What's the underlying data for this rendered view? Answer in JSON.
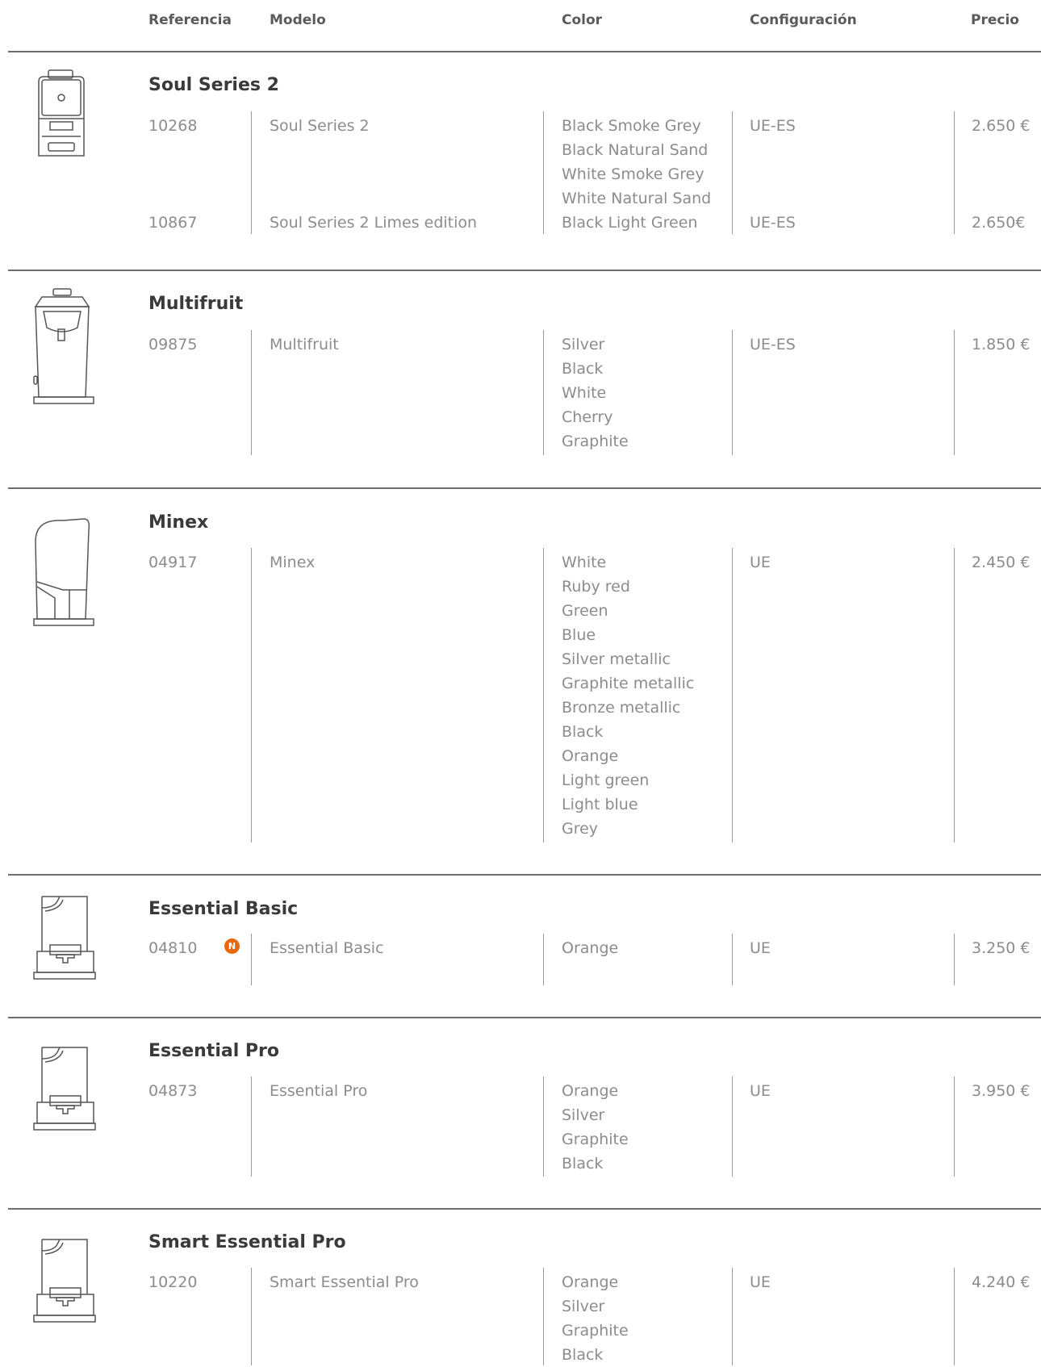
{
  "headers": {
    "referencia": "Referencia",
    "modelo": "Modelo",
    "color": "Color",
    "configuracion": "Configuración",
    "precio": "Precio"
  },
  "products": [
    {
      "name": "Soul Series 2",
      "icon": "soul-series-2-juicer-icon",
      "rows": [
        {
          "ref": "10268",
          "model": "Soul Series 2",
          "colors": [
            "Black Smoke Grey",
            "Black Natural Sand",
            "White Smoke Grey",
            "White Natural Sand"
          ],
          "config": "UE-ES",
          "price": "2.650 €"
        },
        {
          "ref": "10867",
          "model": "Soul Series 2 Limes edition",
          "colors": [
            "Black Light Green"
          ],
          "config": "UE-ES",
          "price": "2.650€"
        }
      ]
    },
    {
      "name": "Multifruit",
      "icon": "multifruit-juicer-icon",
      "rows": [
        {
          "ref": "09875",
          "model": "Multifruit",
          "colors": [
            "Silver",
            "Black",
            "White",
            "Cherry",
            "Graphite"
          ],
          "config": "UE-ES",
          "price": "1.850 €"
        }
      ]
    },
    {
      "name": "Minex",
      "icon": "minex-juicer-icon",
      "rows": [
        {
          "ref": "04917",
          "model": "Minex",
          "colors": [
            "White",
            "Ruby red",
            "Green",
            "Blue",
            "Silver metallic",
            "Graphite metallic",
            "Bronze metallic",
            "Black",
            "Orange",
            "Light green",
            "Light blue",
            "Grey"
          ],
          "config": "UE",
          "price": "2.450 €"
        }
      ]
    },
    {
      "name": "Essential Basic",
      "icon": "essential-basic-juicer-icon",
      "badge": "N",
      "badge_color": "#e4690f",
      "rows": [
        {
          "ref": "04810",
          "model": "Essential Basic",
          "colors": [
            "Orange"
          ],
          "config": "UE",
          "price": "3.250 €"
        }
      ]
    },
    {
      "name": "Essential Pro",
      "icon": "essential-pro-juicer-icon",
      "rows": [
        {
          "ref": "04873",
          "model": "Essential Pro",
          "colors": [
            "Orange",
            "Silver",
            "Graphite",
            "Black"
          ],
          "config": "UE",
          "price": "3.950 €"
        }
      ]
    },
    {
      "name": "Smart Essential Pro",
      "icon": "smart-essential-pro-juicer-icon",
      "rows": [
        {
          "ref": "10220",
          "model": "Smart Essential Pro",
          "colors": [
            "Orange",
            "Silver",
            "Graphite",
            "Black"
          ],
          "config": "UE",
          "price": "4.240 €"
        }
      ]
    }
  ]
}
